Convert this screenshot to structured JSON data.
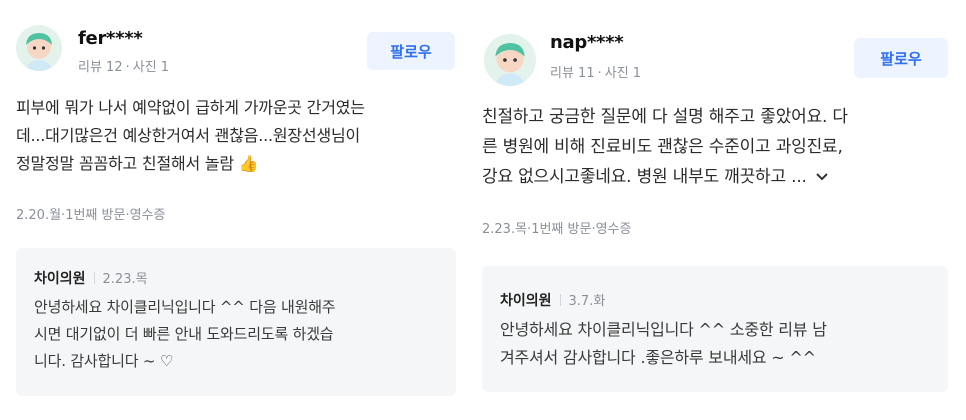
{
  "reviews": [
    {
      "nickname": "fer****",
      "review_count": "리뷰 12",
      "photo_count": "사진 1",
      "follow_label": "팔로우",
      "text_lines": [
        "피부에 뭐가 나서 예약없이 급하게 가까운곳 간거였는",
        "데...대기많은건 예상한거여서 괜찮음...원장선생님이",
        "정말정말 꼼꼼하고 친절해서 놀람 👍"
      ],
      "date": "2.20.월",
      "visit": "1번째 방문",
      "receipt": "영수증",
      "reply": {
        "name": "차이의원",
        "date": "2.23.목",
        "text_lines": [
          "안녕하세요 차이클리닉입니다 ^^ 다음 내원해주",
          "시면 대기없이 더 빠른 안내 도와드리도록 하겠습",
          "니다. 감사합니다 ~ ♡"
        ]
      }
    },
    {
      "nickname": "nap****",
      "review_count": "리뷰 11",
      "photo_count": "사진 1",
      "follow_label": "팔로우",
      "text_lines": [
        "친절하고 궁금한 질문에 다 설명 해주고 좋았어요. 다",
        "른 병원에 비해 진료비도 괜찮은 수준이고 과잉진료,",
        "강요 없으시고좋네요. 병원 내부도 깨끗하고 ..."
      ],
      "date": "2.23.목",
      "visit": "1번째 방문",
      "receipt": "영수증",
      "reply": {
        "name": "차이의원",
        "date": "3.7.화",
        "text_lines": [
          "안녕하세요 차이클리닉입니다 ^^ 소중한 리뷰 남",
          "겨주셔서 감사합니다 .좋은하루 보내세요 ~ ^^"
        ]
      }
    }
  ],
  "icons": {
    "avatar": "user-avatar-icon",
    "expand": "chevron-down-icon"
  },
  "colors": {
    "accent": "#2f6ff0",
    "follow_bg": "#edf4ff",
    "reply_bg": "#f5f6f7",
    "muted": "#8a8f98"
  }
}
